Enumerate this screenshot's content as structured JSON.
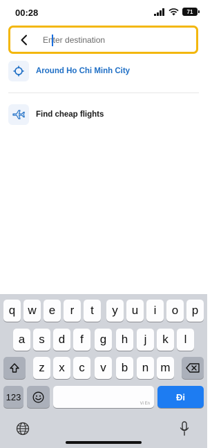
{
  "status_bar": {
    "time": "00:28",
    "battery": "71"
  },
  "search": {
    "placeholder": "Enter destination",
    "value": ""
  },
  "suggestions": [
    {
      "label": "Around Ho Chi Minh City",
      "icon": "locate-icon",
      "color": "#1f6fc5"
    },
    {
      "label": "Find cheap flights",
      "icon": "plane-icon",
      "color": "#1a1a1a"
    }
  ],
  "keyboard": {
    "row1": [
      "q",
      "w",
      "e",
      "r",
      "t",
      "y",
      "u",
      "i",
      "o",
      "p"
    ],
    "row2": [
      "a",
      "s",
      "d",
      "f",
      "g",
      "h",
      "j",
      "k",
      "l"
    ],
    "row3": [
      "z",
      "x",
      "c",
      "v",
      "b",
      "n",
      "m"
    ],
    "numbers_label": "123",
    "space_hint": "Vi En",
    "go_label": "Đi",
    "accent": "#1d7cf2"
  },
  "colors": {
    "search_border": "#f3b70e",
    "link_blue": "#1f6fc5"
  }
}
